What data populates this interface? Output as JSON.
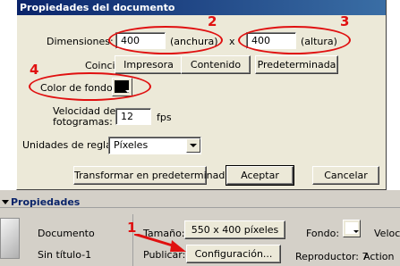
{
  "dialog": {
    "title": "Propiedades del documento",
    "dimensions_label": "Dimensiones:",
    "width_value": "400",
    "width_unit": "(anchura)",
    "times": "x",
    "height_value": "400",
    "height_unit": "(altura)",
    "match_label": "Coincidir:",
    "match_printer": "Impresora",
    "match_contents": "Contenido",
    "match_default": "Predeterminada",
    "bgcolor_label": "Color de fondo:",
    "bgcolor_value": "#000000",
    "framerate_label_1": "Velocidad de",
    "framerate_label_2": "fotogramas:",
    "framerate_value": "12",
    "framerate_unit": "fps",
    "ruler_label": "Unidades de regla:",
    "ruler_value": "Píxeles",
    "make_default": "Transformar en predeterminado",
    "ok": "Aceptar",
    "cancel": "Cancelar"
  },
  "annotations": {
    "n1": "1",
    "n2": "2",
    "n3": "3",
    "n4": "4",
    "color": "#e01010"
  },
  "props": {
    "header": "Propiedades",
    "doc_label": "Documento",
    "doc_name": "Sin título-1",
    "size_label": "Tamaño:",
    "size_button": "550 x 400 píxeles",
    "publish_label": "Publicar:",
    "settings_button": "Configuración...",
    "bg_label": "Fondo:",
    "bg_color": "#ffffff",
    "player_label": "Reproductor: 7",
    "speed_label": "Veloci",
    "action_label": "Action"
  }
}
